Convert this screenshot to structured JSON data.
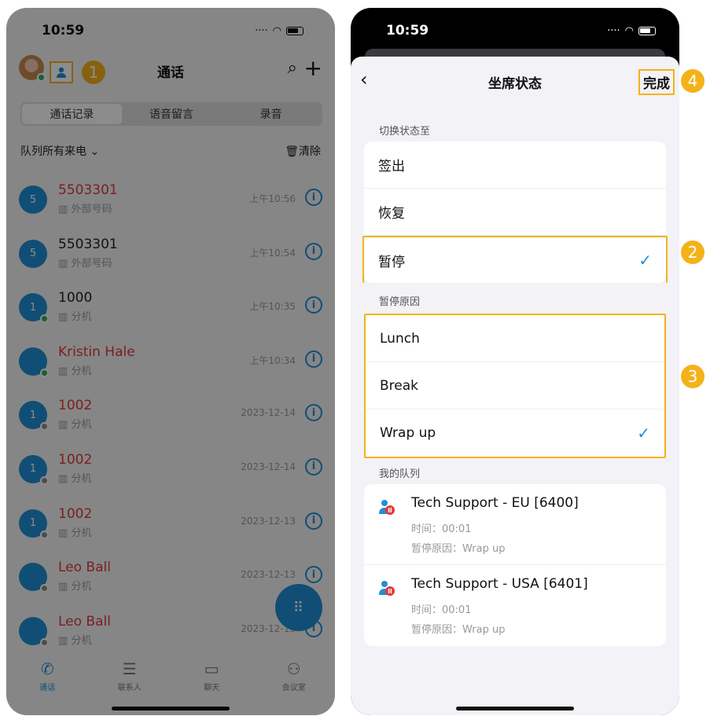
{
  "left": {
    "status_time": "10:59",
    "title": "通话",
    "badge1": "1",
    "tabs": [
      "通话记录",
      "语音留言",
      "录音"
    ],
    "filter_label": "队列所有来电",
    "clear_label": "清除",
    "rows": [
      {
        "initial": "5",
        "name": "5503301",
        "sub": "外部号码",
        "time": "上午10:56",
        "missed": true
      },
      {
        "initial": "5",
        "name": "5503301",
        "sub": "外部号码",
        "time": "上午10:54",
        "missed": false
      },
      {
        "initial": "1",
        "name": "1000",
        "sub": "分机",
        "time": "上午10:35",
        "missed": false
      },
      {
        "initial": "",
        "name": "Kristin Hale",
        "sub": "分机",
        "time": "上午10:34",
        "missed": true
      },
      {
        "initial": "1",
        "name": "1002",
        "sub": "分机",
        "time": "2023-12-14",
        "missed": true
      },
      {
        "initial": "1",
        "name": "1002",
        "sub": "分机",
        "time": "2023-12-14",
        "missed": true
      },
      {
        "initial": "1",
        "name": "1002",
        "sub": "分机",
        "time": "2023-12-13",
        "missed": true
      },
      {
        "initial": "",
        "name": "Leo Ball",
        "sub": "分机",
        "time": "2023-12-13",
        "missed": true
      },
      {
        "initial": "",
        "name": "Leo Ball",
        "sub": "分机",
        "time": "2023-12-13",
        "missed": true
      }
    ],
    "bottom_tabs": [
      "通话",
      "联系人",
      "聊天",
      "会议室"
    ]
  },
  "right": {
    "status_time": "10:59",
    "title": "坐席状态",
    "done_label": "完成",
    "switch_section": "切换状态至",
    "status_options": [
      "签出",
      "恢复",
      "暂停"
    ],
    "pause_section": "暂停原因",
    "pause_reasons": [
      "Lunch",
      "Break",
      "Wrap up"
    ],
    "queue_section": "我的队列",
    "queues": [
      {
        "name": "Tech Support - EU [6400]",
        "time": "时间：00:01",
        "reason": "暂停原因：Wrap up"
      },
      {
        "name": "Tech Support - USA [6401]",
        "time": "时间：00:01",
        "reason": "暂停原因：Wrap up"
      }
    ],
    "badges": [
      "2",
      "3",
      "4"
    ]
  },
  "colors": {
    "accent": "#1f8fd6",
    "highlight": "#f4b21a",
    "missed": "#e0393a"
  }
}
